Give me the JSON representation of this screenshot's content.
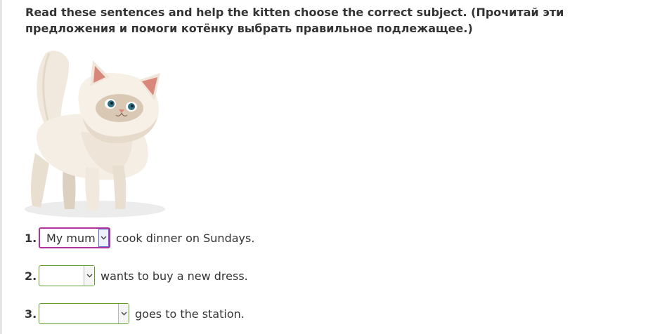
{
  "instruction": "Read these sentences and help the kitten choose the correct subject. (Прочитай эти предложения и помоги котёнку выбрать правильное подлежащее.)",
  "questions": [
    {
      "number": "1.",
      "selected": "My mum",
      "rest": "cook dinner on Sundays."
    },
    {
      "number": "2.",
      "selected": "",
      "rest": "wants to buy a new dress."
    },
    {
      "number": "3.",
      "selected": "",
      "rest": "goes to the station."
    }
  ],
  "colors": {
    "border_default": "#5f9e2a",
    "border_active": "#b0349e",
    "text": "#333333"
  },
  "icons": {
    "dropdown": "chevron-down-icon",
    "illustration": "kitten-illustration"
  }
}
